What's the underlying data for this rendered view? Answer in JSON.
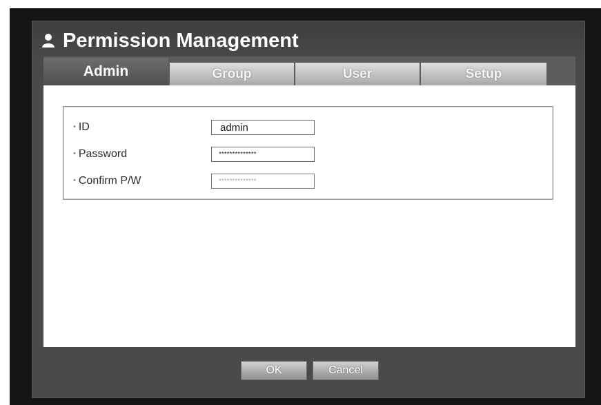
{
  "dialog": {
    "title": "Permission Management",
    "title_icon": "user-icon"
  },
  "tabs": [
    {
      "label": "Admin",
      "active": true
    },
    {
      "label": "Group",
      "active": false
    },
    {
      "label": "User",
      "active": false
    },
    {
      "label": "Setup",
      "active": false
    }
  ],
  "form": {
    "id_label": "ID",
    "id_value": "admin",
    "password_label": "Password",
    "password_value": "**************",
    "confirm_label": "Confirm P/W",
    "confirm_value": "**************"
  },
  "footer": {
    "ok_label": "OK",
    "cancel_label": "Cancel"
  },
  "colors": {
    "dialog_bg": "#4a4a4a",
    "frame_bg": "#151515",
    "content_bg": "#ffffff"
  }
}
